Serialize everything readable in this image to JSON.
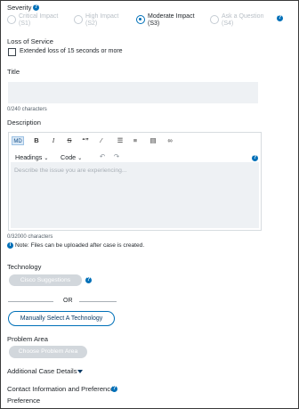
{
  "severity": {
    "label": "Severity",
    "options": [
      {
        "line1": "Critical Impact",
        "line2": "(S1)",
        "selected": false
      },
      {
        "line1": "High Impact",
        "line2": "(S2)",
        "selected": false
      },
      {
        "line1": "Moderate Impact",
        "line2": "(S3)",
        "selected": true
      },
      {
        "line1": "Ask a Question",
        "line2": "(S4)",
        "selected": false
      }
    ]
  },
  "loss_of_service": {
    "label": "Loss of Service",
    "checkbox_label": "Extended loss of 15 seconds or more",
    "checked": false
  },
  "title": {
    "label": "Title",
    "value": "",
    "char_count": "0/240 characters"
  },
  "description": {
    "label": "Description",
    "toolbar": {
      "source_label": "MD",
      "bold": "B",
      "italic": "I",
      "strike": "S",
      "quote": "“”",
      "clear": "⁄",
      "bullet_list": "☰",
      "numbered_list": "≡",
      "block": "▤",
      "link": "∞",
      "headings": "Headings",
      "code": "Code",
      "undo": "↶",
      "redo": "↷"
    },
    "placeholder": "Describe the issue you are experiencing...",
    "char_count": "0/32000 characters",
    "note": "Note: Files can be uploaded after case is created."
  },
  "technology": {
    "label": "Technology",
    "suggestions_button": "Cisco Suggestions",
    "or_text": "OR",
    "manual_button": "Manually Select A Technology"
  },
  "problem_area": {
    "label": "Problem Area",
    "button": "Choose Problem Area"
  },
  "additional_details": {
    "label": "Additional Case Details"
  },
  "contact": {
    "label": "Contact Information and Preference"
  },
  "preference": {
    "label": "Preference"
  },
  "colors": {
    "accent": "#0070b8",
    "input_bg": "#eef1f4",
    "disabled_pill": "#d2d7dc"
  },
  "icons": {
    "help": "help-circle-icon",
    "info": "info-circle-icon",
    "expand": "caret-down-icon"
  }
}
